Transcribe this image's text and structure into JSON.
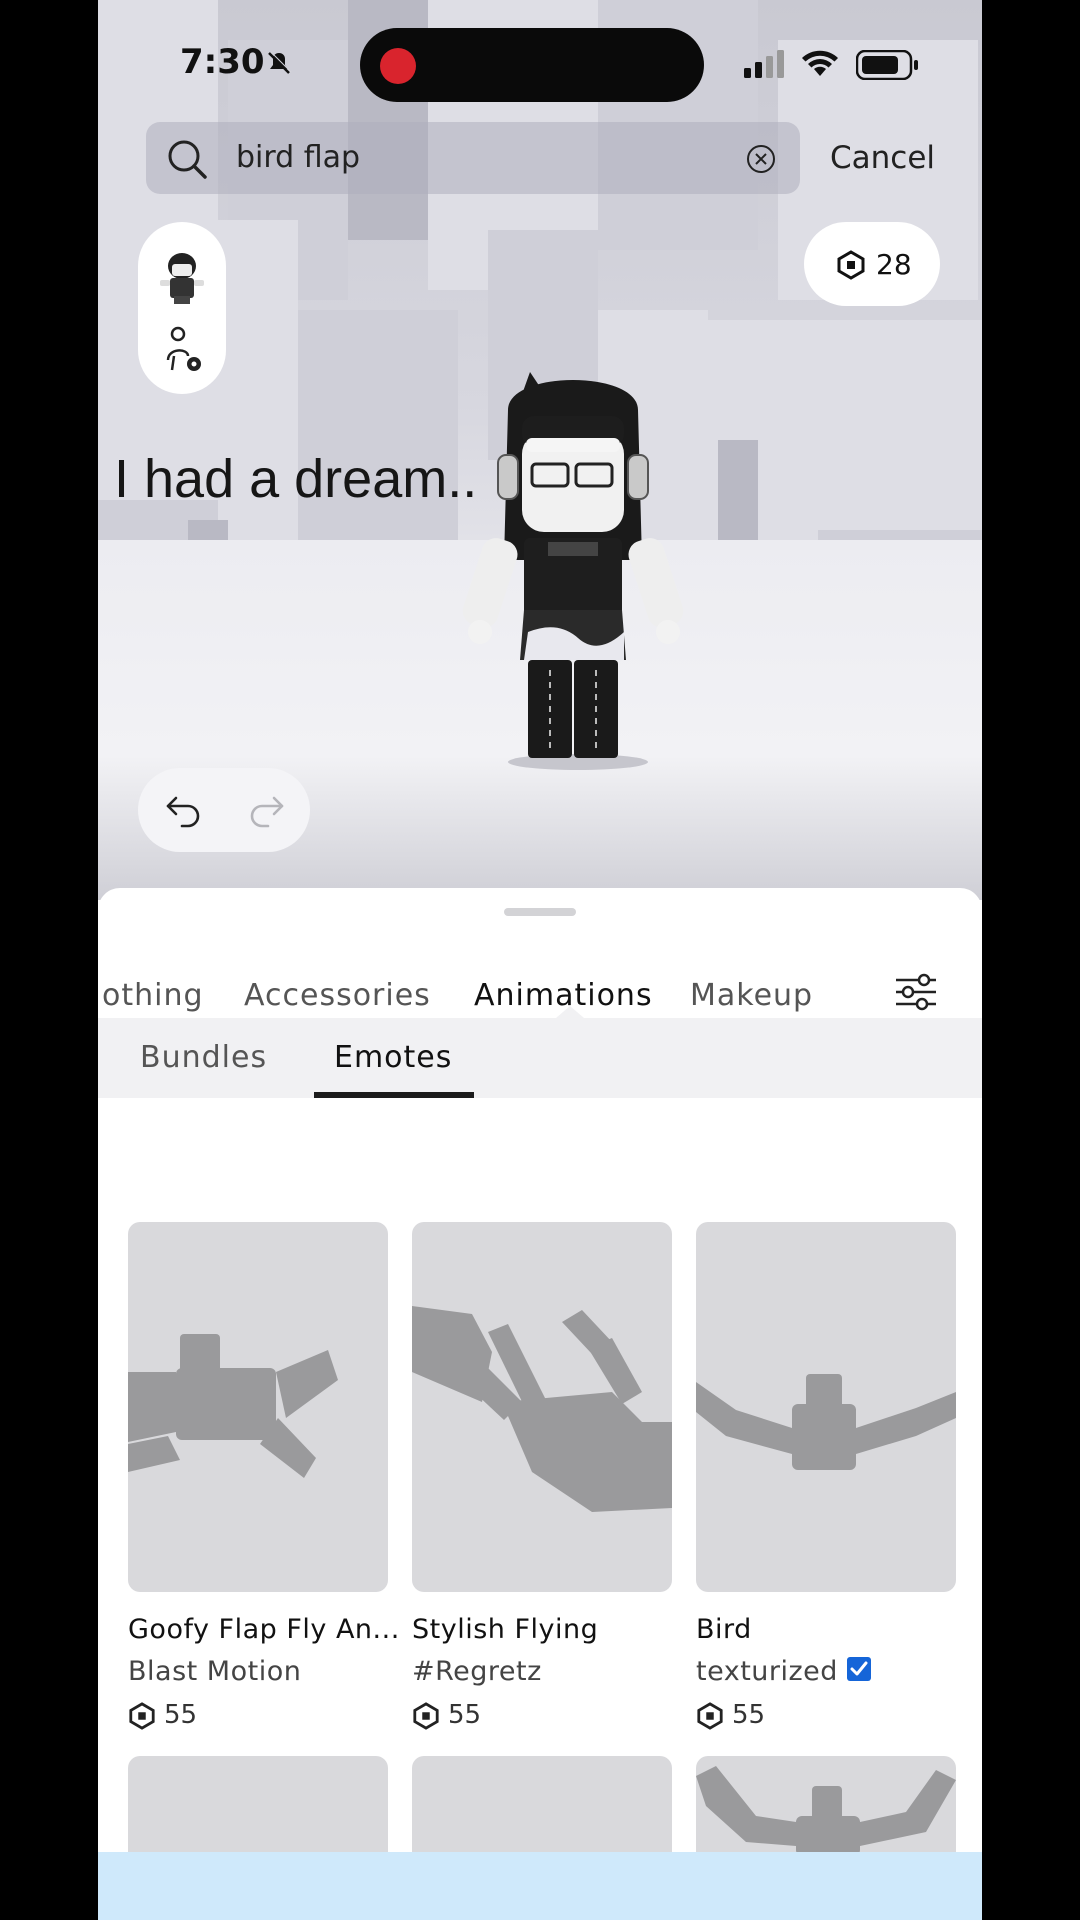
{
  "status_bar": {
    "time": "7:30"
  },
  "search": {
    "query": "bird flap",
    "cancel_label": "Cancel"
  },
  "robux": {
    "balance": "28"
  },
  "scene": {
    "chat_bubble_text": "I had a dream.."
  },
  "categories": {
    "tabs": [
      "othing",
      "Accessories",
      "Animations",
      "Makeup"
    ],
    "active": "Animations"
  },
  "subtabs": {
    "items": [
      "Bundles",
      "Emotes"
    ],
    "active": "Emotes"
  },
  "items": [
    {
      "name": "Goofy Flap Fly An...",
      "creator": "Blast Motion",
      "price": "55",
      "verified": false
    },
    {
      "name": "Stylish Flying",
      "creator": "#Regretz",
      "price": "55",
      "verified": false
    },
    {
      "name": "Bird",
      "creator": "texturized",
      "price": "55",
      "verified": true
    }
  ],
  "colors": {
    "accent_verified": "#1565d8",
    "record_dot": "#d9242d",
    "bottom_bar": "#cfe9fb"
  }
}
